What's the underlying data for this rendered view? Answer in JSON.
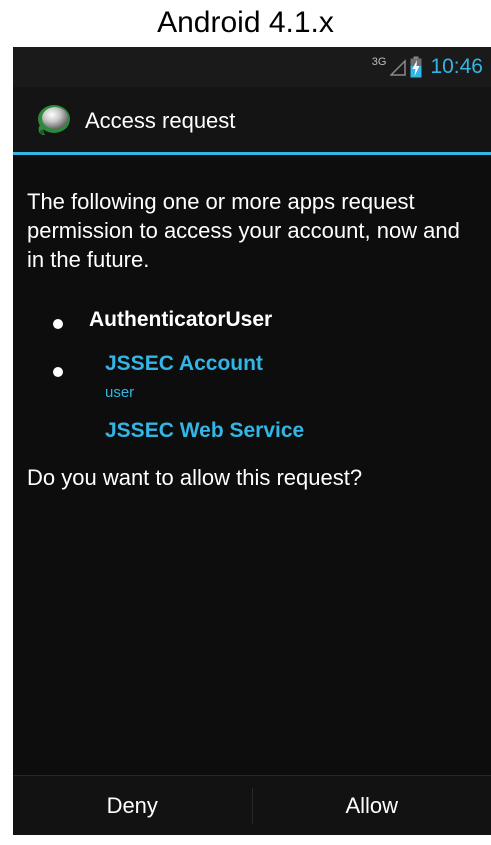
{
  "caption": "Android 4.1.x",
  "status_bar": {
    "network_label": "3G",
    "time": "10:46",
    "icons": [
      "signal-icon",
      "battery-charging-icon"
    ]
  },
  "dialog": {
    "title": "Access request",
    "icon": "authenticator-app-icon",
    "message": "The following one or more apps request permission to access your account, now and in the future.",
    "requesting_app": "AuthenticatorUser",
    "account_type": "JSSEC Account",
    "account_name": "user",
    "service": "JSSEC Web Service",
    "question": "Do you want to allow this request?",
    "deny_label": "Deny",
    "allow_label": "Allow"
  },
  "colors": {
    "accent": "#33b5e5",
    "background": "#0d0d0d",
    "text": "#ffffff"
  }
}
